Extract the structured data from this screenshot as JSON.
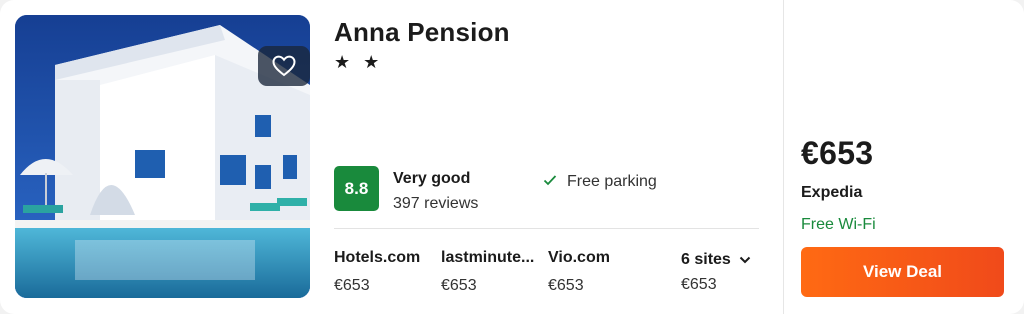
{
  "hotel": {
    "name": "Anna Pension",
    "stars_text": "★ ★"
  },
  "rating": {
    "score": "8.8",
    "label": "Very good",
    "reviews": "397 reviews"
  },
  "amenity": {
    "label": "Free parking",
    "icon": "check-icon"
  },
  "sites": [
    {
      "name": "Hotels.com",
      "price": "€653"
    },
    {
      "name": "lastminute...",
      "price": "€653"
    },
    {
      "name": "Vio.com",
      "price": "€653"
    }
  ],
  "more_sites": {
    "label": "6 sites",
    "price": "€653",
    "icon": "chevron-down-icon"
  },
  "deal": {
    "price": "€653",
    "provider": "Expedia",
    "perk": "Free Wi-Fi",
    "button_label": "View Deal"
  },
  "colors": {
    "rating_badge": "#198a3c",
    "perk_text": "#198a3c",
    "deal_button": "#ff6a13"
  },
  "photo": {
    "favorite_icon": "heart-icon"
  }
}
